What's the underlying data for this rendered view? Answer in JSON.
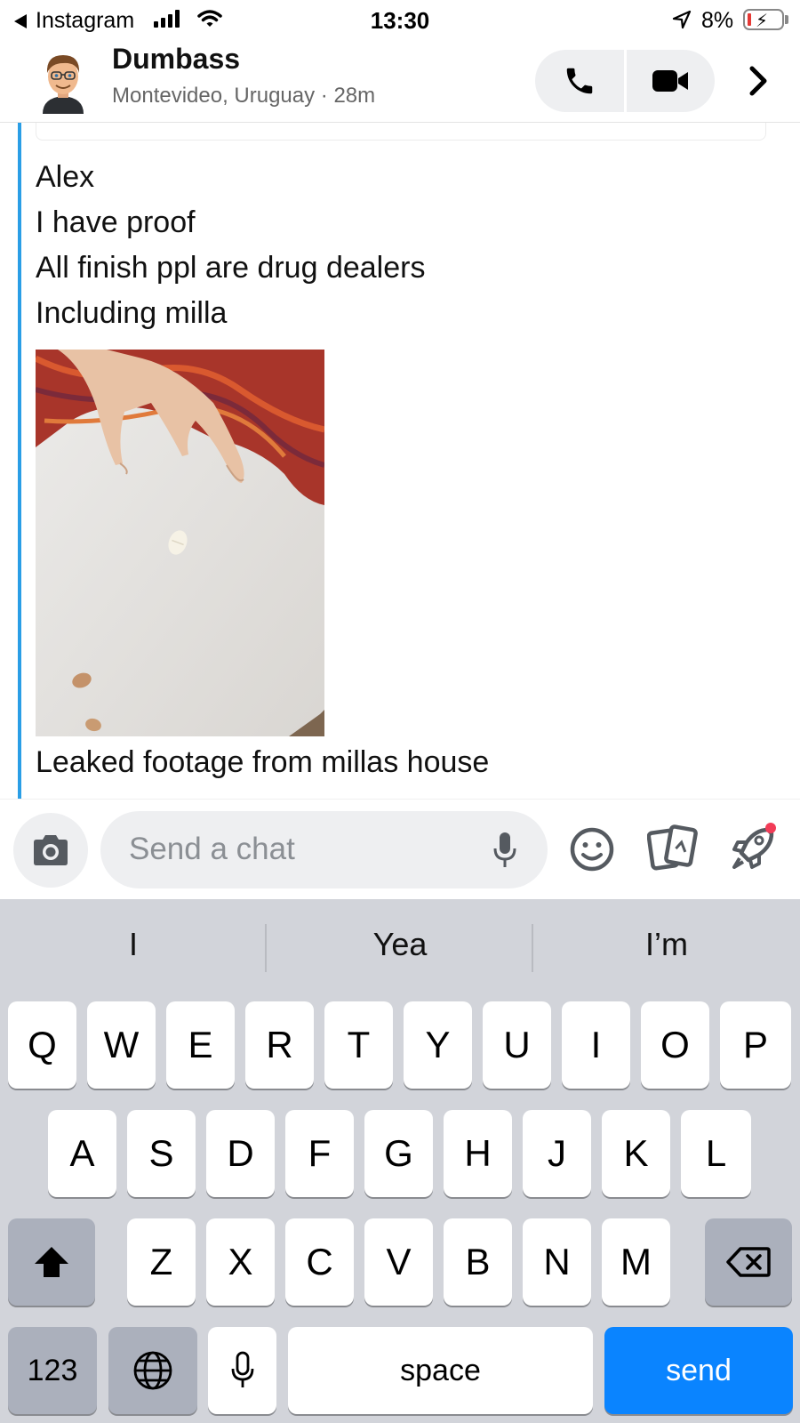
{
  "status_bar": {
    "back_app": "Instagram",
    "time": "13:30",
    "battery_percent": "8%"
  },
  "header": {
    "contact_name": "Dumbass",
    "contact_subtitle": "Montevideo, Uruguay · 28m",
    "icons": [
      "avatar",
      "phone-icon",
      "video-icon",
      "chevron-right-icon"
    ]
  },
  "messages": [
    "Alex",
    "I have proof",
    "All finish ppl are drug dealers",
    "Including milla",
    "Leaked footage from millas house"
  ],
  "composer": {
    "placeholder": "Send a chat",
    "icons": [
      "camera-icon",
      "microphone-icon",
      "emoji-icon",
      "cards-icon",
      "rocket-icon"
    ],
    "accent_color": "#2a9ee6",
    "notification_dot_color": "#f23c57"
  },
  "keyboard": {
    "suggestions": [
      "I",
      "Yea",
      "I’m"
    ],
    "row1": [
      "Q",
      "W",
      "E",
      "R",
      "T",
      "Y",
      "U",
      "I",
      "O",
      "P"
    ],
    "row2": [
      "A",
      "S",
      "D",
      "F",
      "G",
      "H",
      "J",
      "K",
      "L"
    ],
    "row3": [
      "Z",
      "X",
      "C",
      "V",
      "B",
      "N",
      "M"
    ],
    "numbers_label": "123",
    "space_label": "space",
    "send_label": "send",
    "send_color": "#0a84ff"
  }
}
